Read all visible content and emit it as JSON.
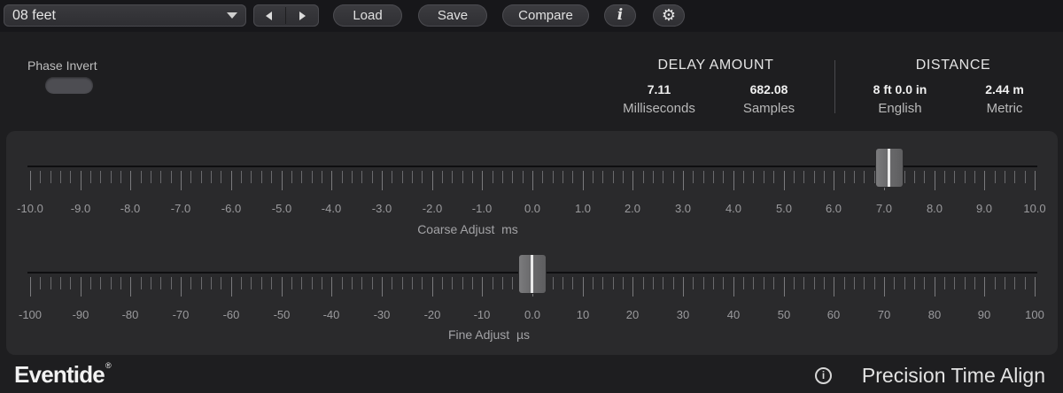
{
  "toolbar": {
    "preset": "08 feet",
    "load_label": "Load",
    "save_label": "Save",
    "compare_label": "Compare",
    "info_glyph": "i",
    "settings_glyph": "⚙",
    "prev_icon": "triangle-left",
    "next_icon": "triangle-right"
  },
  "phase": {
    "label": "Phase Invert",
    "state": "off"
  },
  "delay": {
    "title": "DELAY AMOUNT",
    "ms_value": "7.11",
    "ms_unit": "Milliseconds",
    "samples_value": "682.08",
    "samples_unit": "Samples"
  },
  "distance": {
    "title": "DISTANCE",
    "english_value": "8 ft 0.0 in",
    "english_unit": "English",
    "metric_value": "2.44 m",
    "metric_unit": "Metric"
  },
  "coarse": {
    "label": "Coarse Adjust",
    "unit": "ms",
    "min": -10,
    "max": 10,
    "value": 7.11,
    "tick_labels": [
      "-10.0",
      "-9.0",
      "-8.0",
      "-7.0",
      "-6.0",
      "-5.0",
      "-4.0",
      "-3.0",
      "-2.0",
      "-1.0",
      "0.0",
      "1.0",
      "2.0",
      "3.0",
      "4.0",
      "5.0",
      "6.0",
      "7.0",
      "8.0",
      "9.0",
      "10.0"
    ]
  },
  "fine": {
    "label": "Fine Adjust",
    "unit": "µs",
    "min": -100,
    "max": 100,
    "value": 0,
    "tick_labels": [
      "-100",
      "-90",
      "-80",
      "-70",
      "-60",
      "-50",
      "-40",
      "-30",
      "-20",
      "-10",
      "0.0",
      "10",
      "20",
      "30",
      "40",
      "50",
      "60",
      "70",
      "80",
      "90",
      "100"
    ]
  },
  "footer": {
    "brand": "Eventide",
    "trademark": "®",
    "product": "Precision Time Align",
    "info_glyph": "i"
  },
  "colors": {
    "background": "#1e1e20",
    "panel": "#2a2a2c",
    "handle": "#6a6a6c",
    "text": "#d6d6d6"
  }
}
